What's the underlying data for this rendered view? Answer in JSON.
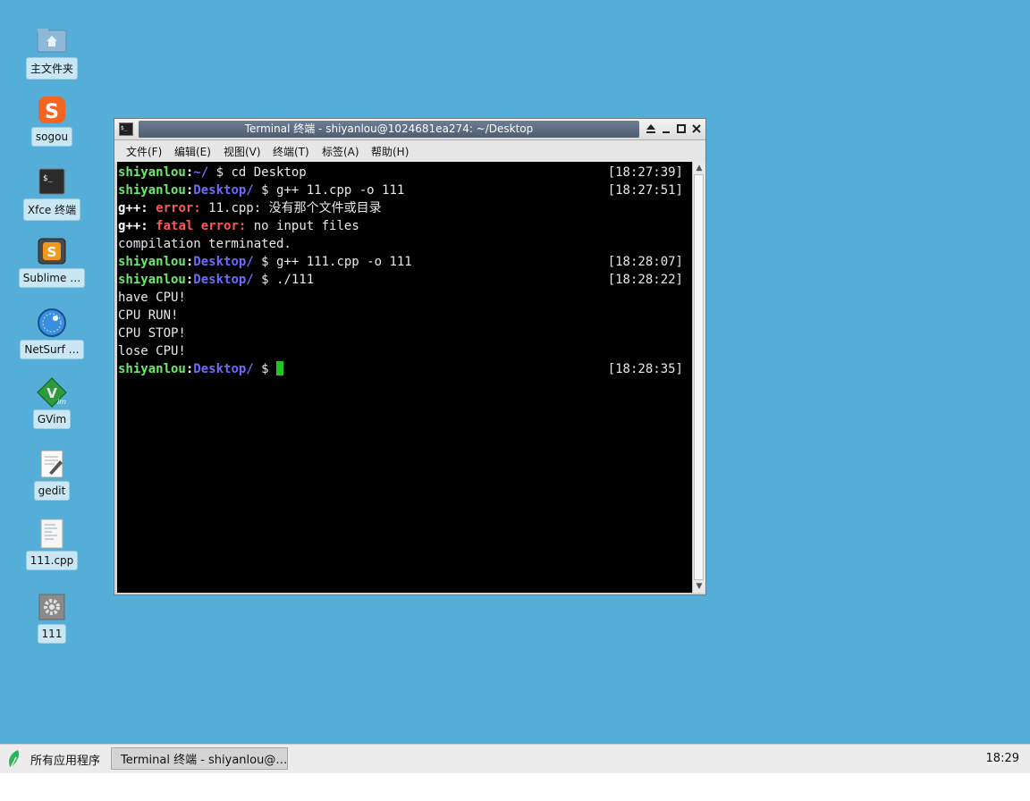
{
  "desktop": {
    "icons": [
      {
        "label": "主文件夹",
        "icon": "home-folder-icon"
      },
      {
        "label": "sogou",
        "icon": "sogou-icon"
      },
      {
        "label": "Xfce 终端",
        "icon": "terminal-icon"
      },
      {
        "label": "Sublime …",
        "icon": "sublime-text-icon"
      },
      {
        "label": "NetSurf …",
        "icon": "netsurf-icon"
      },
      {
        "label": "GVim",
        "icon": "gvim-icon"
      },
      {
        "label": "gedit",
        "icon": "gedit-icon"
      },
      {
        "label": "111.cpp",
        "icon": "text-file-icon"
      },
      {
        "label": "111",
        "icon": "executable-gear-icon"
      }
    ]
  },
  "window": {
    "title": "Terminal 终端 - shiyanlou@1024681ea274: ~/Desktop",
    "menu": [
      "文件(F)",
      "编辑(E)",
      "视图(V)",
      "终端(T)",
      "标签(A)",
      "帮助(H)"
    ]
  },
  "terminal": {
    "user": "shiyanlou",
    "lines": {
      "l1_dir": "~/",
      "l1_cmd": " $ cd Desktop",
      "l1_ts": "[18:27:39]",
      "l2_dir": "Desktop/",
      "l2_cmd": " $ g++ 11.cpp -o 111",
      "l2_ts": "[18:27:51]",
      "l3_prefix": "g++:",
      "l3_err": "error:",
      "l3_msg": " 11.cpp: 没有那个文件或目录",
      "l4_prefix": "g++:",
      "l4_err": "fatal error:",
      "l4_msg": " no input files",
      "l5": "compilation terminated.",
      "l6_dir": "Desktop/",
      "l6_cmd": " $ g++ 111.cpp -o 111",
      "l6_ts": "[18:28:07]",
      "l7_dir": "Desktop/",
      "l7_cmd": " $ ./111",
      "l7_ts": "[18:28:22]",
      "l8": "have CPU!",
      "l9": "CPU RUN!",
      "l10": "CPU STOP!",
      "l11": "lose CPU!",
      "l12_dir": "Desktop/",
      "l12_cmd": " $ ",
      "l12_ts": "[18:28:35]"
    }
  },
  "taskbar": {
    "apps_label": "所有应用程序",
    "task_label": "Terminal 终端 - shiyanlou@…",
    "clock": "18:29"
  },
  "colors": {
    "desktop_bg": "#54aed8",
    "prompt_user": "#6ee86e",
    "prompt_dir": "#6c6cff",
    "error": "#ff5555",
    "cursor": "#22c422"
  }
}
